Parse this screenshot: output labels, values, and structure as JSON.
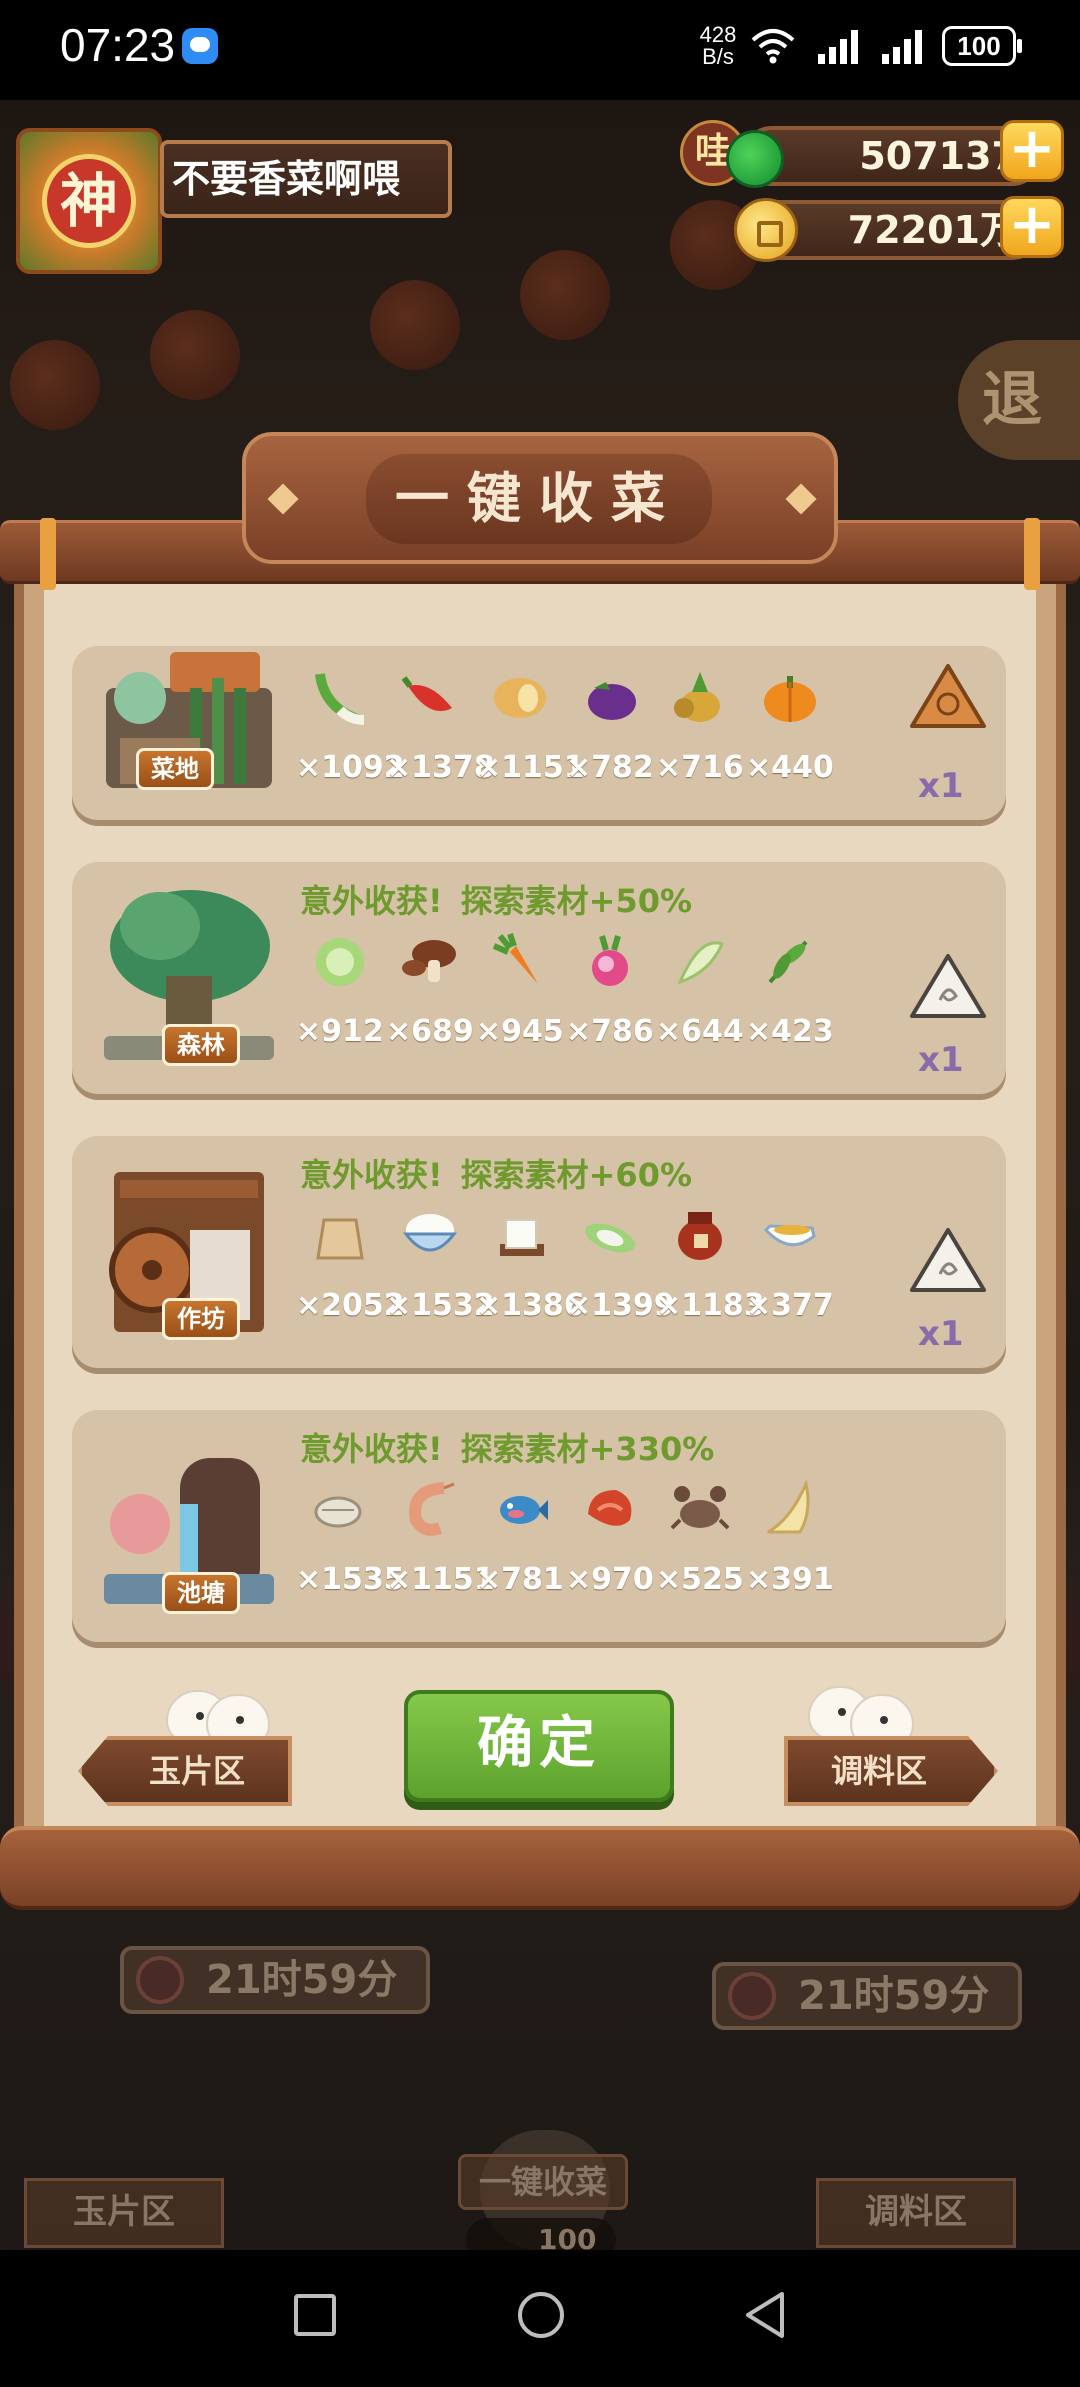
{
  "status_bar": {
    "time": "07:23",
    "net_speed_value": "428",
    "net_speed_unit": "B/s",
    "battery": "100"
  },
  "player": {
    "avatar_char": "神",
    "name": "不要香菜啊喂"
  },
  "currency": {
    "wa_char": "哇",
    "jade": "507137",
    "coins": "72201万"
  },
  "exit_char": "退",
  "panel": {
    "title": "一键收菜",
    "rows": [
      {
        "location": "菜地",
        "bonus": "",
        "bonus_text": "",
        "items": [
          {
            "icon": "scallion-icon",
            "count": "×1092"
          },
          {
            "icon": "chili-pepper-icon",
            "count": "×1378"
          },
          {
            "icon": "potato-icon",
            "count": "×1151"
          },
          {
            "icon": "eggplant-icon",
            "count": "×782"
          },
          {
            "icon": "pineapple-icon",
            "count": "×716"
          },
          {
            "icon": "pumpkin-icon",
            "count": "×440"
          }
        ],
        "stone": "orange-sun-stone-icon",
        "multiplier": "x1"
      },
      {
        "location": "森林",
        "bonus": "意外收获!",
        "bonus_text": "探索素材+50%",
        "items": [
          {
            "icon": "cabbage-icon",
            "count": "×912"
          },
          {
            "icon": "mushroom-icon",
            "count": "×689"
          },
          {
            "icon": "carrot-icon",
            "count": "×945"
          },
          {
            "icon": "radish-icon",
            "count": "×786"
          },
          {
            "icon": "bamboo-shoot-icon",
            "count": "×644"
          },
          {
            "icon": "herb-icon",
            "count": "×423"
          }
        ],
        "stone": "white-swirl-stone-icon",
        "multiplier": "x1"
      },
      {
        "location": "作坊",
        "bonus": "意外收获!",
        "bonus_text": "探索素材+60%",
        "items": [
          {
            "icon": "flour-sack-icon",
            "count": "×2052"
          },
          {
            "icon": "rice-bowl-icon",
            "count": "×1532"
          },
          {
            "icon": "tofu-icon",
            "count": "×1386"
          },
          {
            "icon": "rice-leaf-icon",
            "count": "×1399"
          },
          {
            "icon": "wine-jar-icon",
            "count": "×1183"
          },
          {
            "icon": "sauce-boat-icon",
            "count": "×377"
          }
        ],
        "stone": "white-swirl-stone-icon",
        "multiplier": "x1"
      },
      {
        "location": "池塘",
        "bonus": "意外收获!",
        "bonus_text": "探索素材+330%",
        "items": [
          {
            "icon": "clam-icon",
            "count": "×1535"
          },
          {
            "icon": "shrimp-icon",
            "count": "×1151"
          },
          {
            "icon": "fish-icon",
            "count": "×781"
          },
          {
            "icon": "red-meat-icon",
            "count": "×970"
          },
          {
            "icon": "crab-icon",
            "count": "×525"
          },
          {
            "icon": "shark-fin-icon",
            "count": "×391"
          }
        ],
        "stone": "",
        "multiplier": ""
      }
    ],
    "left_button": "玉片区",
    "confirm_button": "确定",
    "right_button": "调料区"
  },
  "background": {
    "timer_left": "21时59分",
    "timer_right": "21时59分",
    "tag_left": "玉片区",
    "tag_right": "调料区",
    "harvest_label": "一键收菜",
    "harvest_count": "100"
  },
  "colors": {
    "bonus_green": "#6e9a2e",
    "confirm_green": "#6db437",
    "panel_bg": "#e8d8bf",
    "card_bg": "#d6c2a6"
  }
}
